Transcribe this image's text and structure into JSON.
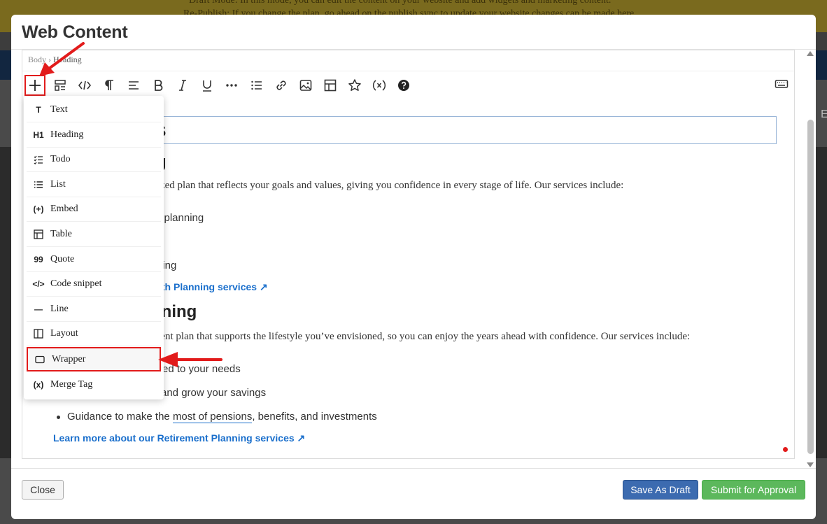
{
  "background": {
    "banner_line1": "Draft Mode: In this mode, you can edit the content on your website and add widgets and marketing content.",
    "banner_line2": "Re-Publish: If you change the plan, go ahead on the publish sync to update your website changes can be made here.",
    "side_letter": "E"
  },
  "modal": {
    "title": "Web Content"
  },
  "breadcrumb": {
    "root": "Body",
    "sep": "›",
    "current": "Heading"
  },
  "toolbar": {
    "items": [
      "plus-icon",
      "block-format-icon",
      "code-icon",
      "paragraph-icon",
      "align-icon",
      "bold-icon",
      "italic-icon",
      "underline-icon",
      "more-icon",
      "list-icon",
      "link-icon",
      "image-icon",
      "table-icon",
      "star-icon",
      "variable-icon",
      "help-icon",
      "keyboard-icon"
    ]
  },
  "content": {
    "heading_visible": "s",
    "section1_heading": "g",
    "section1_para": "alized plan that reflects your goals and values, giving you confidence in every stage of life. Our services include:",
    "section1_item1": "e planning",
    "section1_item2": "ning",
    "section1_link": "lth Planning services ↗",
    "section2_heading": "nning",
    "section2_para": "ement plan that supports the lifestyle you’ve envisioned, so you can enjoy the years ahead with confidence. Our services include:",
    "section2_item1": "ed to your needs",
    "section2_item2": "and grow your savings",
    "section2_item3_pre": "Guidance to make the ",
    "section2_item3_link": "most of pensions",
    "section2_item3_post": ", benefits, and investments",
    "section2_link": "Learn more about our Retirement Planning services ↗"
  },
  "menu": {
    "items": [
      {
        "label": "Text",
        "icon": "text-icon",
        "glyph": "T"
      },
      {
        "label": "Heading",
        "icon": "heading-icon",
        "glyph": "H1"
      },
      {
        "label": "Todo",
        "icon": "todo-icon",
        "glyph": ""
      },
      {
        "label": "List",
        "icon": "list-icon",
        "glyph": ""
      },
      {
        "label": "Embed",
        "icon": "embed-icon",
        "glyph": "(+)"
      },
      {
        "label": "Table",
        "icon": "table-icon",
        "glyph": ""
      },
      {
        "label": "Quote",
        "icon": "quote-icon",
        "glyph": "99"
      },
      {
        "label": "Code snippet",
        "icon": "code-icon",
        "glyph": "</>"
      },
      {
        "label": "Line",
        "icon": "line-icon",
        "glyph": "—"
      },
      {
        "label": "Layout",
        "icon": "layout-icon",
        "glyph": ""
      },
      {
        "label": "Wrapper",
        "icon": "wrapper-icon",
        "glyph": ""
      },
      {
        "label": "Merge Tag",
        "icon": "merge-tag-icon",
        "glyph": "(x)"
      }
    ],
    "selected": "Wrapper"
  },
  "footer": {
    "close_label": "Close",
    "draft_label": "Save As Draft",
    "submit_label": "Submit for Approval"
  },
  "colors": {
    "highlight": "#e21b1b",
    "link": "#1a6fcc",
    "draft_button": "#3c6bb0",
    "submit_button": "#5cb85c"
  }
}
